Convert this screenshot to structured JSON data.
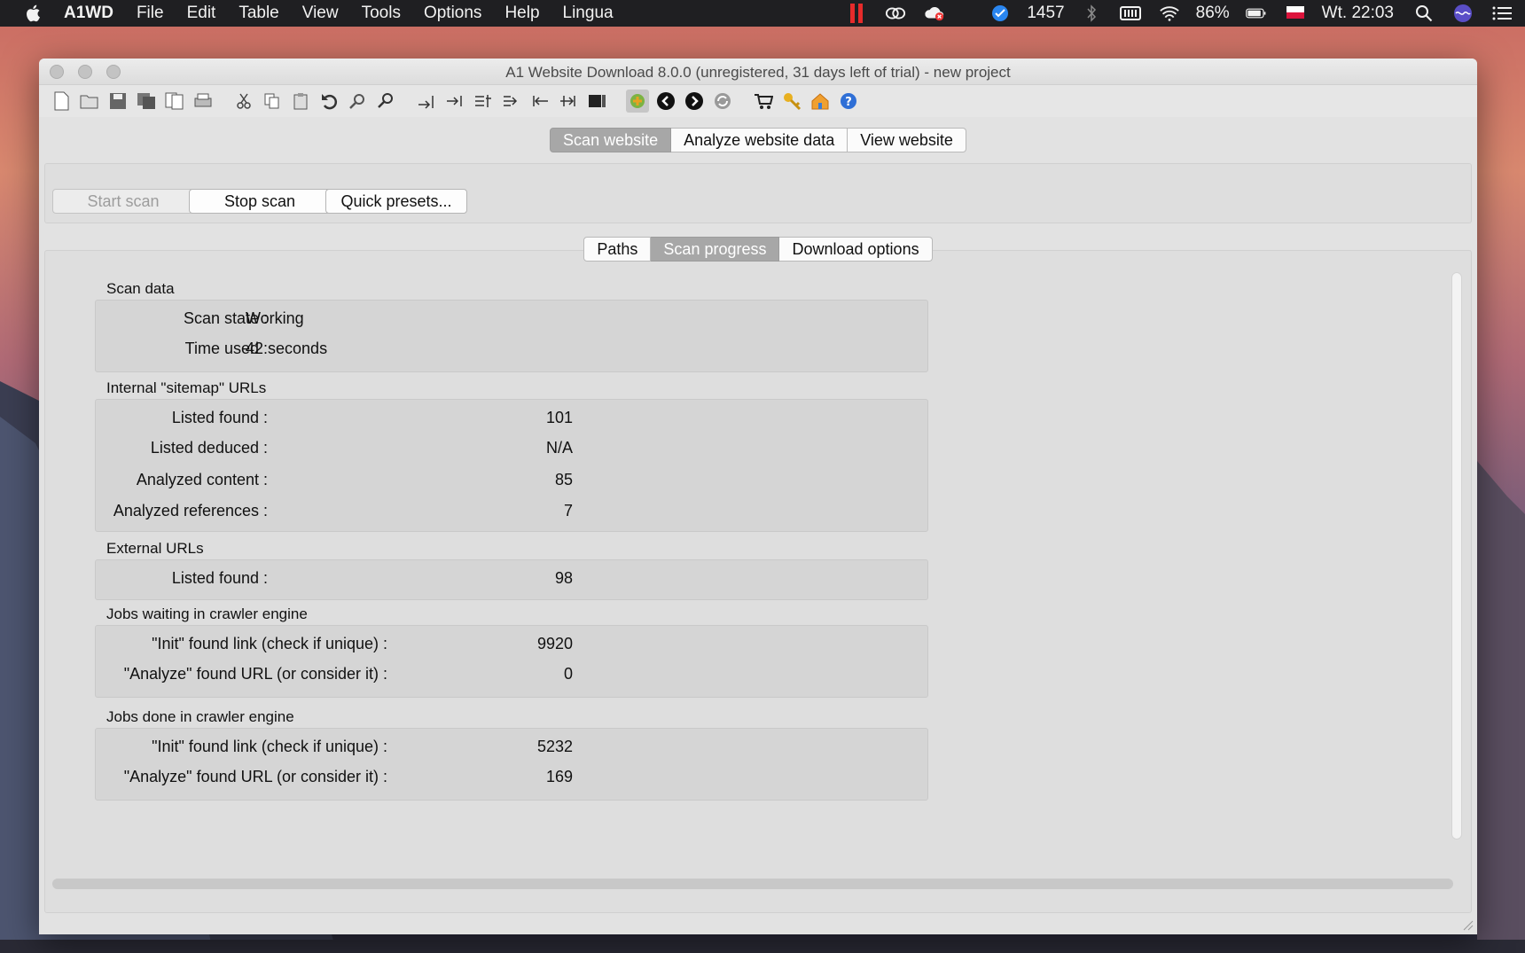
{
  "menubar": {
    "app_name": "A1WD",
    "items": [
      "File",
      "Edit",
      "Table",
      "View",
      "Tools",
      "Options",
      "Help",
      "Lingua"
    ],
    "status": {
      "notification_count": "1457",
      "battery": "86%",
      "clock": "Wt. 22:03"
    }
  },
  "window": {
    "title": "A1 Website Download 8.0.0 (unregistered, 31 days left of trial) - new project"
  },
  "main_tabs": {
    "items": [
      "Scan website",
      "Analyze website data",
      "View website"
    ],
    "selected": "Scan website"
  },
  "scan_controls": {
    "start_label": "Start scan",
    "stop_label": "Stop scan",
    "presets_label": "Quick presets..."
  },
  "sub_tabs": {
    "items": [
      "Paths",
      "Scan progress",
      "Download options"
    ],
    "selected": "Scan progress"
  },
  "scan_data": {
    "title": "Scan data",
    "state_label": "Scan state :",
    "state_value": "Working",
    "time_label": "Time used :",
    "time_value": "42 seconds"
  },
  "internal_urls": {
    "title": "Internal \"sitemap\" URLs",
    "rows": [
      {
        "label": "Listed found :",
        "value": "101"
      },
      {
        "label": "Listed deduced :",
        "value": "N/A"
      },
      {
        "label": "Analyzed content :",
        "value": "85"
      },
      {
        "label": "Analyzed references :",
        "value": "7"
      }
    ]
  },
  "external_urls": {
    "title": "External URLs",
    "rows": [
      {
        "label": "Listed found :",
        "value": "98"
      }
    ]
  },
  "jobs_waiting": {
    "title": "Jobs waiting in crawler engine",
    "rows": [
      {
        "label": "\"Init\" found link (check if unique) :",
        "value": "9920"
      },
      {
        "label": "\"Analyze\" found URL (or consider it) :",
        "value": "0"
      }
    ]
  },
  "jobs_done": {
    "title": "Jobs done in crawler engine",
    "rows": [
      {
        "label": "\"Init\" found link (check if unique) :",
        "value": "5232"
      },
      {
        "label": "\"Analyze\" found URL (or consider it) :",
        "value": "169"
      }
    ]
  }
}
